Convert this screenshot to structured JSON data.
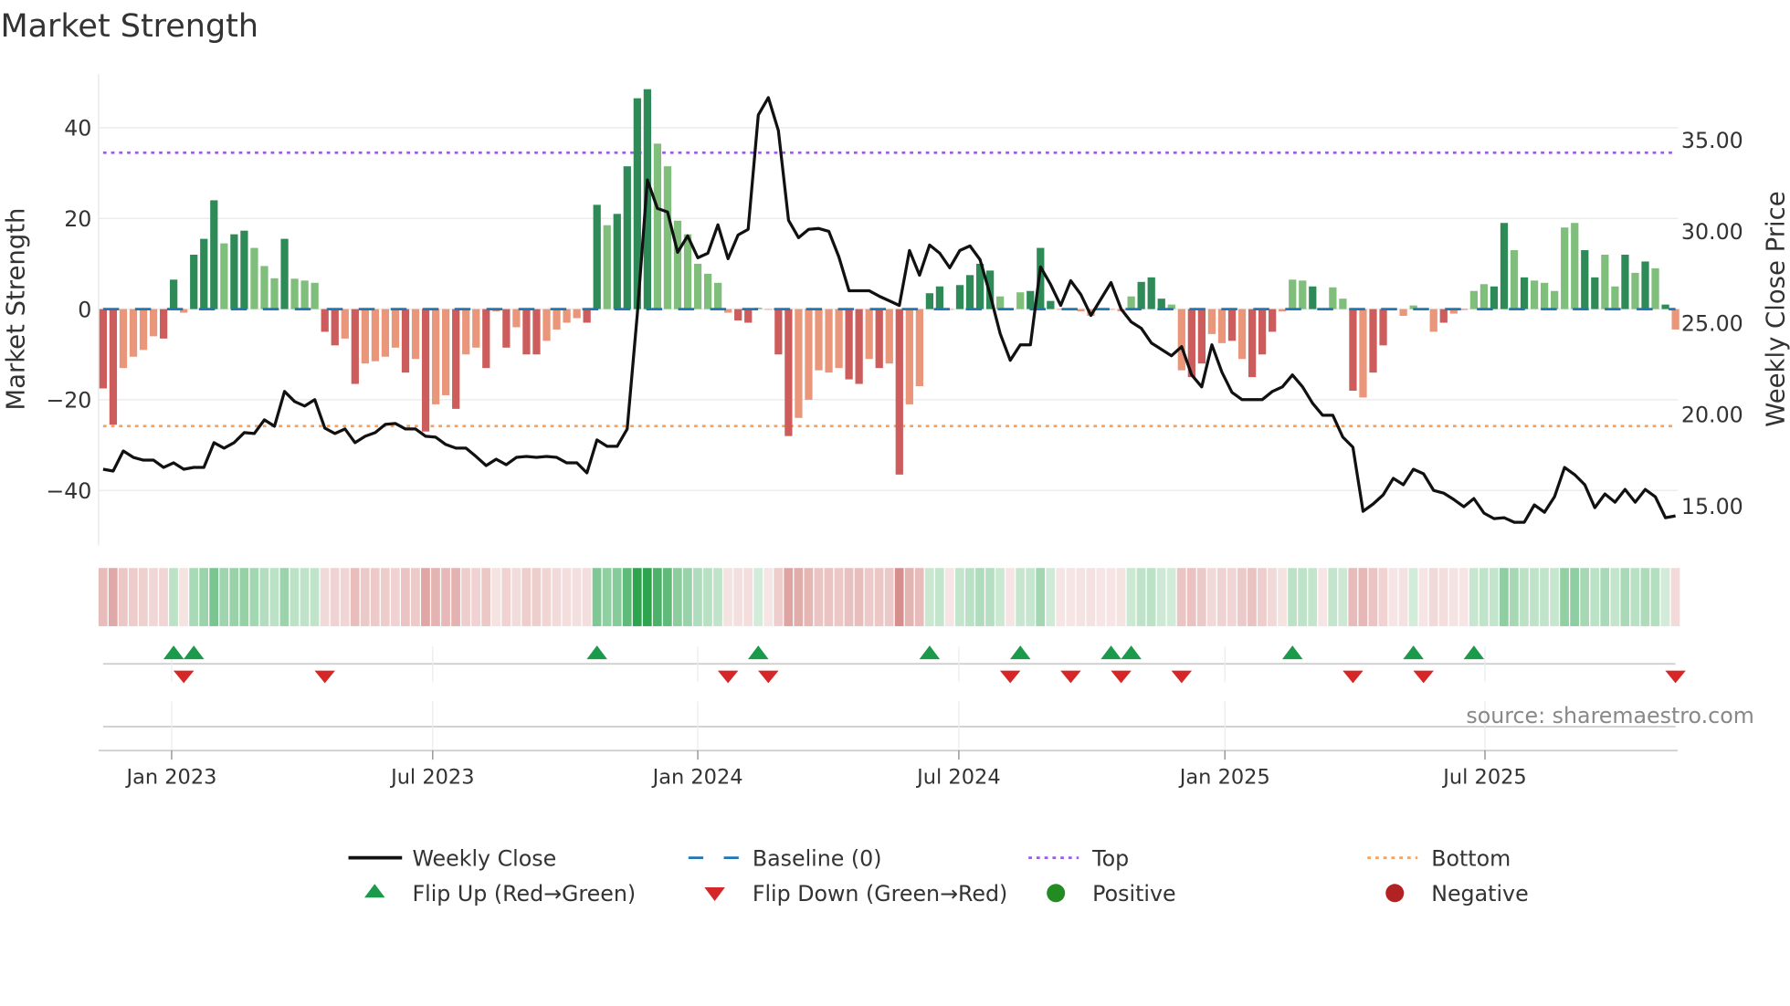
{
  "chart_data": {
    "type": "bar",
    "title": "Market Strength",
    "ylabel": "Market Strength",
    "y2label": "Weekly Close Price",
    "ylim": [
      -48,
      52
    ],
    "y2lim": [
      12.2,
      38.4
    ],
    "yticks": [
      {
        "v": 40,
        "label": "40"
      },
      {
        "v": 20,
        "label": "20"
      },
      {
        "v": 0,
        "label": "0"
      },
      {
        "v": -20,
        "label": "−20"
      },
      {
        "v": -40,
        "label": "−40"
      }
    ],
    "y2ticks": [
      {
        "v": 35,
        "label": "35.00"
      },
      {
        "v": 30,
        "label": "30.00"
      },
      {
        "v": 25,
        "label": "25.00"
      },
      {
        "v": 20,
        "label": "20.00"
      },
      {
        "v": 15,
        "label": "15.00"
      }
    ],
    "frequency": "weekly",
    "start_week_index_of_jan_2023": 6.8,
    "xticks": [
      {
        "week": 6.8,
        "label": "Jan 2023"
      },
      {
        "week": 32.7,
        "label": "Jul 2023"
      },
      {
        "week": 59.0,
        "label": "Jan 2024"
      },
      {
        "week": 84.9,
        "label": "Jul 2024"
      },
      {
        "week": 111.3,
        "label": "Jan 2025"
      },
      {
        "week": 137.1,
        "label": "Jul 2025"
      }
    ],
    "top_level": 34.5,
    "bottom_level": -25.8,
    "baseline": 0,
    "strength": [
      -17.5,
      -25.5,
      -13,
      -10.5,
      -9,
      -6,
      -6.5,
      6.5,
      -0.8,
      12,
      15.5,
      24,
      14.5,
      16.5,
      17.3,
      13.5,
      9.5,
      6.8,
      15.5,
      6.7,
      6.3,
      5.8,
      -5,
      -8,
      -6.5,
      -16.5,
      -12,
      -11.5,
      -10.5,
      -8.5,
      -14,
      -11,
      -27,
      -21,
      -19,
      -22,
      -10,
      -8.5,
      -13,
      -0.5,
      -8.5,
      -4,
      -10,
      -10,
      -7,
      -4.5,
      -3,
      -2,
      -3,
      23,
      18.5,
      21,
      31.5,
      46.5,
      48.5,
      36.5,
      31.5,
      19.5,
      16.5,
      10,
      7.8,
      5.8,
      -0.8,
      -2.5,
      -3,
      0.3,
      0,
      -10,
      -28,
      -24,
      -20,
      -13.5,
      -14,
      -13,
      -15.5,
      -16.5,
      -11,
      -13,
      -12,
      -36.5,
      -21,
      -17,
      3.5,
      5,
      0,
      5.3,
      7.5,
      10,
      8.5,
      2.8,
      0,
      3.7,
      4,
      13.5,
      1.8,
      0,
      0,
      -0.5,
      -1.5,
      0,
      0,
      -0.5,
      2.8,
      6,
      7,
      2.3,
      1,
      -13.5,
      -15,
      -12,
      -5.5,
      -7.5,
      -7,
      -11,
      -15,
      -10,
      -5,
      -0.5,
      6.5,
      6.3,
      5,
      0,
      4.8,
      2.3,
      -18,
      -19.5,
      -14,
      -8,
      0,
      -1.5,
      0.8,
      0,
      -5,
      -3,
      -1,
      0,
      4,
      5.5,
      5,
      19,
      13,
      7,
      6.3,
      5.8,
      4,
      18,
      19,
      13,
      7,
      12,
      5,
      12,
      8,
      10.5,
      9,
      1,
      -4.5
    ],
    "strength_shade": "DDLLLLDDLDDDLDDLLLDLLLDDLDLLLLDLDLLDLLDLDLDDLLLLDDLDDDDLLLLLLLLDDLLDDLLLLLDDLDLDLLDDLDDDDLLLDDDLLLLDLLLDDDLLDDLLDLDDDLLLDLLLDLDDLLLLLDLDLLDDLDLLLLLDDLLDLDLDLLD",
    "weekly_close": [
      17.0,
      16.9,
      18.0,
      17.65,
      17.5,
      17.5,
      17.1,
      17.35,
      17.0,
      17.1,
      17.1,
      18.45,
      18.15,
      18.45,
      19.0,
      18.95,
      19.7,
      19.35,
      21.25,
      20.7,
      20.45,
      20.8,
      19.25,
      18.95,
      19.2,
      18.45,
      18.8,
      19.0,
      19.45,
      19.5,
      19.2,
      19.2,
      18.8,
      18.75,
      18.35,
      18.15,
      18.15,
      17.7,
      17.2,
      17.55,
      17.25,
      17.65,
      17.7,
      17.65,
      17.7,
      17.65,
      17.35,
      17.35,
      16.8,
      18.6,
      18.25,
      18.25,
      19.2,
      25.5,
      32.8,
      31.25,
      31.05,
      28.85,
      29.75,
      28.55,
      28.8,
      30.35,
      28.5,
      29.8,
      30.1,
      36.35,
      37.3,
      35.5,
      30.6,
      29.65,
      30.1,
      30.15,
      30.0,
      28.6,
      26.75,
      26.75,
      26.75,
      26.45,
      26.2,
      25.95,
      28.95,
      27.6,
      29.25,
      28.8,
      28.0,
      28.95,
      29.2,
      28.45,
      26.55,
      24.4,
      22.95,
      23.8,
      23.8,
      28.05,
      27.1,
      25.95,
      27.3,
      26.55,
      25.4,
      26.3,
      27.2,
      25.75,
      25.05,
      24.7,
      23.9,
      23.55,
      23.2,
      23.7,
      22.15,
      21.5,
      23.8,
      22.3,
      21.2,
      20.8,
      20.8,
      20.8,
      21.25,
      21.5,
      22.15,
      21.5,
      20.6,
      19.95,
      19.95,
      18.75,
      18.2,
      14.7,
      15.1,
      15.6,
      16.5,
      16.15,
      17.0,
      16.75,
      15.85,
      15.7,
      15.35,
      14.95,
      15.4,
      14.6,
      14.3,
      14.35,
      14.1,
      14.1,
      15.05,
      14.65,
      15.5,
      17.1,
      16.7,
      16.15,
      14.9,
      15.65,
      15.2,
      15.9,
      15.2,
      15.9,
      15.5,
      14.35,
      14.45
    ],
    "flip_up_weeks": [
      7,
      9,
      49,
      65,
      82,
      91,
      100,
      102,
      118,
      130,
      136
    ],
    "flip_down_weeks": [
      8,
      22,
      62,
      66,
      90,
      96,
      101,
      107,
      124,
      131,
      156
    ],
    "legend": {
      "placement": "bottom",
      "items": [
        {
          "label": "Weekly Close",
          "symbol": "line",
          "color": "#111111"
        },
        {
          "label": "Baseline (0)",
          "symbol": "dash",
          "color": "#1f77b4"
        },
        {
          "label": "Top",
          "symbol": "dot",
          "color": "#9b5de5"
        },
        {
          "label": "Bottom",
          "symbol": "dot",
          "color": "#f4a261"
        },
        {
          "label": "Flip Up (Red→Green)",
          "symbol": "triangle-up",
          "color": "#1a9a4a"
        },
        {
          "label": "Flip Down (Green→Red)",
          "symbol": "triangle-down",
          "color": "#d62728"
        },
        {
          "label": "Positive",
          "symbol": "circle",
          "color": "#228b22"
        },
        {
          "label": "Negative",
          "symbol": "circle",
          "color": "#b22222"
        }
      ]
    },
    "source": "source: sharemaestro.com"
  },
  "colors": {
    "pos_strong": "#2e8b57",
    "pos_weak": "#7fbf7b",
    "neg_strong": "#cd5c5c",
    "neg_weak": "#e9967a",
    "heat_pos": "#2ea44f",
    "heat_neg": "#c0504d",
    "up": "#1a9a4a",
    "down": "#d62728"
  }
}
